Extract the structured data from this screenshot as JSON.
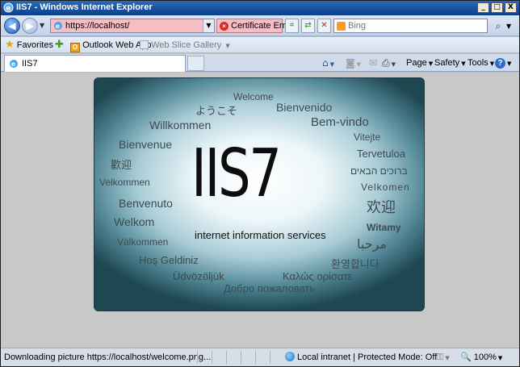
{
  "window": {
    "title": "IIS7 - Windows Internet Explorer",
    "buttons": [
      "_",
      "□",
      "X"
    ]
  },
  "address_bar": {
    "prefix": "https://",
    "url": "https://localhost/",
    "cert_error": "Certificate Error"
  },
  "search": {
    "placeholder": "Bing",
    "go_icon": "search-icon"
  },
  "favorites_bar": {
    "favorites": "Favorites",
    "items": [
      "Outlook Web App",
      "Web Slice Gallery"
    ]
  },
  "tab": {
    "label": "IIS7"
  },
  "command_bar": {
    "page": "Page",
    "safety": "Safety",
    "tools": "Tools",
    "help": "?"
  },
  "page": {
    "logo": "IIS7",
    "subtitle": "internet information services",
    "greetings": [
      "Welcome",
      "ようこそ",
      "Bienvenido",
      "Willkommen",
      "Bem-vindo",
      "Vitejte",
      "Bienvenue",
      "Tervetuloa",
      "歡迎",
      "ברוכים הבאים",
      "Velkommen",
      "Velkomen",
      "Benvenuto",
      "欢迎",
      "Welkom",
      "Witamy",
      "Välkommen",
      "مرحبا",
      "Hoş Geldiniz",
      "환영합니다",
      "Üdvözöljük",
      "Καλώς ορίσατε",
      "Добро пожаловать"
    ]
  },
  "status_bar": {
    "text": "Downloading picture https://localhost/welcome.png...",
    "zone": "Local intranet | Protected Mode: Off",
    "zoom": "100%"
  },
  "colors": {
    "title_bar": "#0b3f8a",
    "address_error": "#f7bdc4",
    "content_bg": "#c8c8c8",
    "panel_edge": "#1f4752"
  }
}
